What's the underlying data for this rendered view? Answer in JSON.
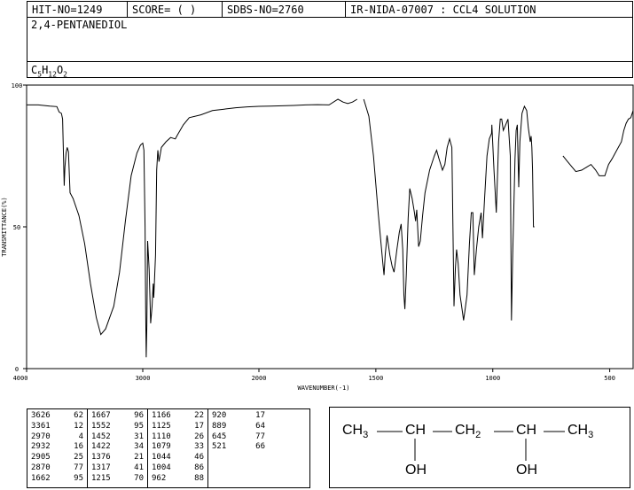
{
  "header": {
    "hit_no": "HIT-NO=1249",
    "score": "SCORE=  (   )",
    "sdbs_no": "SDBS-NO=2760",
    "ir_nida": "IR-NIDA-07007 : CCL4 SOLUTION"
  },
  "compound": {
    "name": "2,4-PENTANEDIOL",
    "formula_c": "C",
    "formula_c_sub": "5",
    "formula_h": "H",
    "formula_h_sub": "12",
    "formula_o": "O",
    "formula_o_sub": "2"
  },
  "chart_data": {
    "type": "line",
    "xlabel": "WAVENUMBER(-1)",
    "ylabel": "TRANSMITTANCE(%)",
    "xlim": [
      4000,
      400
    ],
    "ylim": [
      0,
      100
    ],
    "x_ticks": [
      "4000",
      "3000",
      "2000",
      "1500",
      "1000",
      "500"
    ],
    "y_ticks": [
      "100",
      "50",
      "0"
    ],
    "segments": [
      [
        [
          4000,
          93.0
        ],
        [
          3900,
          93.0
        ],
        [
          3800,
          92.6
        ],
        [
          3740,
          92.4
        ],
        [
          3720,
          90.5
        ],
        [
          3700,
          90.0
        ],
        [
          3690,
          88.0
        ],
        [
          3676,
          64.5
        ],
        [
          3670,
          71.0
        ],
        [
          3660,
          76.0
        ],
        [
          3650,
          78.0
        ],
        [
          3640,
          76.5
        ],
        [
          3626,
          62.0
        ],
        [
          3600,
          60.0
        ],
        [
          3550,
          54.0
        ],
        [
          3500,
          44.0
        ],
        [
          3450,
          30.0
        ],
        [
          3400,
          18.0
        ],
        [
          3361,
          12.0
        ],
        [
          3320,
          14.0
        ],
        [
          3250,
          22.0
        ],
        [
          3200,
          34.0
        ],
        [
          3150,
          52.0
        ],
        [
          3100,
          68.0
        ],
        [
          3050,
          76.0
        ],
        [
          3020,
          78.8
        ],
        [
          3000,
          79.5
        ],
        [
          2990,
          77.0
        ],
        [
          2980,
          50.0
        ],
        [
          2975,
          20.0
        ],
        [
          2970,
          4.0
        ],
        [
          2965,
          15.0
        ],
        [
          2958,
          45.0
        ],
        [
          2945,
          35.0
        ],
        [
          2932,
          16.0
        ],
        [
          2920,
          22.0
        ],
        [
          2910,
          30.0
        ],
        [
          2905,
          25.0
        ],
        [
          2890,
          40.0
        ],
        [
          2880,
          70.0
        ],
        [
          2870,
          77.0
        ],
        [
          2860,
          73.0
        ],
        [
          2840,
          78.0
        ],
        [
          2800,
          80.0
        ],
        [
          2760,
          81.5
        ],
        [
          2720,
          81.0
        ],
        [
          2700,
          82.5
        ],
        [
          2650,
          86.0
        ],
        [
          2600,
          88.5
        ],
        [
          2500,
          89.5
        ],
        [
          2400,
          91.0
        ],
        [
          2300,
          91.5
        ],
        [
          2200,
          92.0
        ],
        [
          2100,
          92.3
        ],
        [
          2000,
          92.5
        ],
        [
          1950,
          92.6
        ],
        [
          1900,
          92.7
        ],
        [
          1850,
          92.8
        ],
        [
          1800,
          93.0
        ],
        [
          1750,
          93.1
        ],
        [
          1700,
          93.0
        ],
        [
          1662,
          95.0
        ],
        [
          1640,
          94.0
        ],
        [
          1620,
          93.5
        ],
        [
          1600,
          94.0
        ],
        [
          1580,
          95.0
        ]
      ],
      [
        [
          1552,
          95.0
        ],
        [
          1530,
          89.0
        ],
        [
          1510,
          75.0
        ],
        [
          1490,
          55.0
        ],
        [
          1470,
          37.0
        ],
        [
          1465,
          33.0
        ],
        [
          1460,
          40.0
        ],
        [
          1452,
          47.0
        ],
        [
          1440,
          40.0
        ],
        [
          1430,
          36.0
        ],
        [
          1422,
          34.0
        ],
        [
          1410,
          42.0
        ],
        [
          1400,
          48.0
        ],
        [
          1392,
          51.0
        ],
        [
          1385,
          42.0
        ],
        [
          1380,
          26.0
        ],
        [
          1376,
          21.0
        ],
        [
          1370,
          33.0
        ],
        [
          1362,
          53.0
        ],
        [
          1355,
          63.5
        ],
        [
          1345,
          60.0
        ],
        [
          1335,
          55.0
        ],
        [
          1330,
          52.0
        ],
        [
          1325,
          56.0
        ],
        [
          1317,
          43.0
        ],
        [
          1310,
          45.0
        ],
        [
          1300,
          54.0
        ],
        [
          1290,
          62.0
        ],
        [
          1270,
          70.0
        ],
        [
          1250,
          75.0
        ],
        [
          1240,
          77.0
        ],
        [
          1230,
          74.0
        ],
        [
          1215,
          70.0
        ],
        [
          1205,
          72.0
        ],
        [
          1195,
          78.0
        ],
        [
          1185,
          81.0
        ],
        [
          1175,
          78.0
        ],
        [
          1166,
          22.0
        ],
        [
          1160,
          35.0
        ],
        [
          1155,
          42.0
        ],
        [
          1148,
          37.0
        ],
        [
          1140,
          26.0
        ],
        [
          1130,
          20.0
        ],
        [
          1125,
          17.0
        ],
        [
          1118,
          21.0
        ],
        [
          1110,
          26.0
        ],
        [
          1100,
          44.0
        ],
        [
          1092,
          55.0
        ],
        [
          1085,
          55.0
        ],
        [
          1079,
          33.0
        ],
        [
          1070,
          42.0
        ],
        [
          1060,
          50.0
        ],
        [
          1050,
          55.0
        ],
        [
          1044,
          46.0
        ],
        [
          1035,
          60.0
        ],
        [
          1025,
          75.0
        ],
        [
          1015,
          81.0
        ],
        [
          1005,
          83.0
        ],
        [
          1004,
          86.0
        ],
        [
          995,
          70.0
        ],
        [
          985,
          55.0
        ],
        [
          975,
          80.0
        ],
        [
          968,
          88.0
        ],
        [
          962,
          88.0
        ],
        [
          955,
          84.0
        ],
        [
          945,
          86.0
        ],
        [
          935,
          88.0
        ],
        [
          925,
          75.0
        ],
        [
          920,
          17.0
        ],
        [
          915,
          40.0
        ],
        [
          905,
          74.0
        ],
        [
          900,
          84.0
        ],
        [
          895,
          86.0
        ],
        [
          889,
          64.0
        ],
        [
          884,
          80.0
        ],
        [
          875,
          90.0
        ],
        [
          865,
          92.5
        ],
        [
          855,
          91.0
        ],
        [
          848,
          85.0
        ],
        [
          840,
          80.0
        ],
        [
          836,
          82.0
        ],
        [
          833,
          78.0
        ],
        [
          830,
          70.0
        ],
        [
          826,
          50.0
        ],
        [
          822,
          50.0
        ]
      ],
      [
        [
          700,
          75.0
        ],
        [
          680,
          73.0
        ],
        [
          660,
          71.0
        ],
        [
          645,
          69.5
        ],
        [
          620,
          70.0
        ],
        [
          600,
          71.0
        ],
        [
          580,
          72.0
        ],
        [
          560,
          70.0
        ],
        [
          545,
          68.0
        ],
        [
          521,
          68.0
        ],
        [
          505,
          72.0
        ],
        [
          490,
          74.0
        ],
        [
          470,
          77.0
        ],
        [
          450,
          80.0
        ],
        [
          440,
          84.0
        ],
        [
          430,
          86.5
        ],
        [
          420,
          88.0
        ],
        [
          410,
          88.5
        ],
        [
          400,
          91.0
        ]
      ]
    ]
  },
  "peaks": {
    "columns": [
      [
        [
          "3626",
          "62"
        ],
        [
          "3361",
          "12"
        ],
        [
          "2970",
          "4"
        ],
        [
          "2932",
          "16"
        ],
        [
          "2905",
          "25"
        ],
        [
          "2870",
          "77"
        ],
        [
          "1662",
          "95"
        ]
      ],
      [
        [
          "1667",
          "96"
        ],
        [
          "1552",
          "95"
        ],
        [
          "1452",
          "31"
        ],
        [
          "1422",
          "34"
        ],
        [
          "1376",
          "21"
        ],
        [
          "1317",
          "41"
        ],
        [
          "1215",
          "70"
        ]
      ],
      [
        [
          "1166",
          "22"
        ],
        [
          "1125",
          "17"
        ],
        [
          "1110",
          "26"
        ],
        [
          "1079",
          "33"
        ],
        [
          "1044",
          "46"
        ],
        [
          "1004",
          "86"
        ],
        [
          "962",
          "88"
        ]
      ],
      [
        [
          "920",
          "17"
        ],
        [
          "889",
          "64"
        ],
        [
          "645",
          "77"
        ],
        [
          "521",
          "66"
        ]
      ]
    ]
  },
  "structure": {
    "ch3_left": "CH",
    "ch3_left_sub": "3",
    "ch_a": "CH",
    "ch2": "CH",
    "ch2_sub": "2",
    "ch_b": "CH",
    "ch3_right": "CH",
    "ch3_right_sub": "3",
    "oh_a": "OH",
    "oh_b": "OH"
  }
}
